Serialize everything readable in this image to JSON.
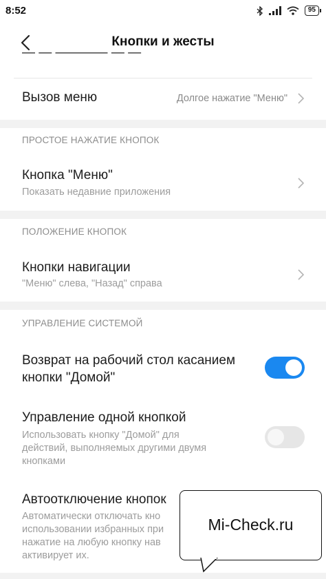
{
  "status_bar": {
    "time": "8:52",
    "battery": "95",
    "icons": [
      "bluetooth-icon",
      "signal-icon",
      "wifi-icon",
      "battery-icon"
    ]
  },
  "header": {
    "title": "Кнопки и жесты"
  },
  "menu_call": {
    "title": "Вызов меню",
    "value": "Долгое нажатие \"Меню\""
  },
  "sections": {
    "simple_press": "ПРОСТОЕ НАЖАТИЕ КНОПОК",
    "button_position": "ПОЛОЖЕНИЕ КНОПОК",
    "system_control": "УПРАВЛЕНИЕ СИСТЕМОЙ"
  },
  "menu_button": {
    "title": "Кнопка \"Меню\"",
    "subtitle": "Показать недавние приложения"
  },
  "nav_buttons": {
    "title": "Кнопки навигации",
    "subtitle": "\"Меню\" слева, \"Назад\" справа"
  },
  "home_return": {
    "title_line1": "Возврат на рабочий стол касанием",
    "title_line2": "кнопки \"Домой\"",
    "enabled": true
  },
  "one_button": {
    "title": "Управление одной кнопкой",
    "subtitle_line1": "Использовать кнопку \"Домой\" для",
    "subtitle_line2": "действий, выполняемых другими двумя",
    "subtitle_line3": "кнопками",
    "enabled": false
  },
  "auto_off": {
    "title": "Автоотключение кнопок",
    "subtitle_line1": "Автоматически отключать кно",
    "subtitle_line2": "использовании избранных при",
    "subtitle_line3": "нажатие на любую кнопку нав",
    "subtitle_line4": "активирует их."
  },
  "watermark": {
    "text": "Mi-Check.ru"
  },
  "colors": {
    "accent": "#1a88f0",
    "section_gap": "#f2f2f2",
    "secondary_text": "#9c9c9c"
  }
}
